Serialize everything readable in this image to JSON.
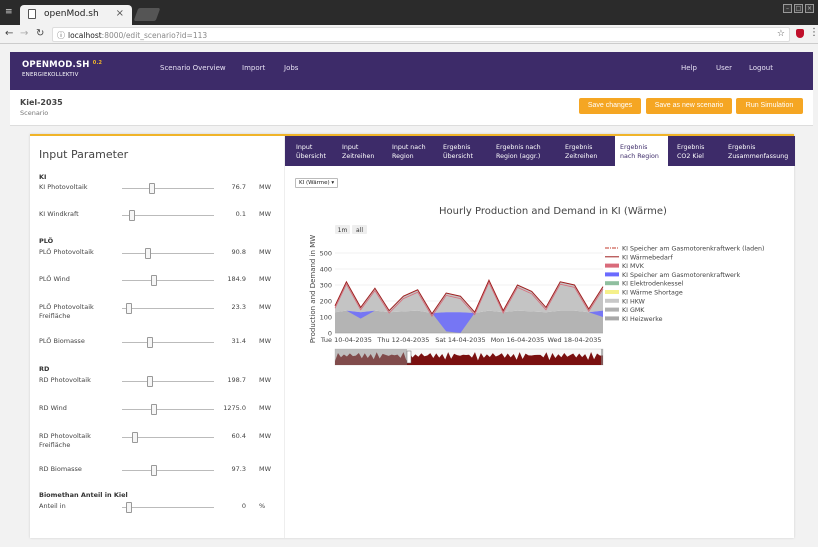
{
  "browser": {
    "tab_title": "openMod.sh",
    "tab_close": "×",
    "url_host": "localhost",
    "url_rest": ":8000/edit_scenario?id=113"
  },
  "nav": {
    "brand": "OPENMOD.SH",
    "version": "0.2",
    "subtitle": "ENERGIEKOLLEKTIV",
    "links": [
      "Scenario Overview",
      "Import",
      "Jobs"
    ],
    "right_links": [
      "Help",
      "User",
      "Logout"
    ]
  },
  "scenario": {
    "name": "Kiel-2035",
    "type": "Scenario",
    "buttons": [
      "Save changes",
      "Save as new scenario",
      "Run Simulation"
    ]
  },
  "params": {
    "title": "Input Parameter",
    "sections": [
      {
        "title": "KI",
        "items": [
          {
            "label": "KI Photovoltaik",
            "value": "76.7",
            "unit": "MW",
            "pos": 0.33
          },
          {
            "label": "KI Windkraft",
            "value": "0.1",
            "unit": "MW",
            "pos": 0.11
          }
        ]
      },
      {
        "title": "PLÖ",
        "items": [
          {
            "label": "PLÖ Photovoltaik",
            "value": "90.8",
            "unit": "MW",
            "pos": 0.27
          },
          {
            "label": "PLÖ Wind",
            "value": "184.9",
            "unit": "MW",
            "pos": 0.33
          },
          {
            "label": "PLÖ Photovoltaik Freifläche",
            "value": "23.3",
            "unit": "MW",
            "pos": 0.05
          },
          {
            "label": "PLÖ Biomasse",
            "value": "31.4",
            "unit": "MW",
            "pos": 0.29
          }
        ]
      },
      {
        "title": "RD",
        "items": [
          {
            "label": "RD Photovoltaik",
            "value": "198.7",
            "unit": "MW",
            "pos": 0.29
          },
          {
            "label": "RD Wind",
            "value": "1275.0",
            "unit": "MW",
            "pos": 0.33
          },
          {
            "label": "RD Photovoltaik Freifläche",
            "value": "60.4",
            "unit": "MW",
            "pos": 0.11
          },
          {
            "label": "RD Biomasse",
            "value": "97.3",
            "unit": "MW",
            "pos": 0.33
          }
        ]
      },
      {
        "title": "Biomethan Anteil in Kiel",
        "items": [
          {
            "label": "Anteil in",
            "value": "0",
            "unit": "%",
            "pos": 0.05
          }
        ]
      }
    ]
  },
  "tabs": [
    {
      "line1": "Input",
      "line2": "Übersicht",
      "active": false
    },
    {
      "line1": "Input",
      "line2": "Zeitreihen",
      "active": false
    },
    {
      "line1": "Input nach",
      "line2": "Region",
      "active": false
    },
    {
      "line1": "Ergebnis",
      "line2": "Übersicht",
      "active": false
    },
    {
      "line1": "Ergebnis nach",
      "line2": "Region (aggr.)",
      "active": false
    },
    {
      "line1": "Ergebnis",
      "line2": "Zeitreihen",
      "active": false
    },
    {
      "line1": "Ergebnis",
      "line2": "nach Region",
      "active": true
    },
    {
      "line1": "Ergebnis",
      "line2": "CO2 Kiel",
      "active": false
    },
    {
      "line1": "Ergebnis",
      "line2": "Zusammenfassung",
      "active": false
    }
  ],
  "region_select": "KI (Wärme)",
  "range_buttons": [
    "1m",
    "all"
  ],
  "colors": {
    "brand": "#3d2b69",
    "accent": "#f5a623"
  },
  "chart_data": {
    "type": "area",
    "title": "Hourly Production and Demand in KI (Wärme)",
    "ylabel": "Production and Demand in MW",
    "ylim": [
      0,
      550
    ],
    "yticks": [
      0,
      100,
      200,
      300,
      400,
      500
    ],
    "xticks": [
      "Tue 10-04-2035",
      "Thu 12-04-2035",
      "Sat 14-04-2035",
      "Mon 16-04-2035",
      "Wed 18-04-2035"
    ],
    "x_days": [
      9.6,
      10,
      10.5,
      11,
      11.5,
      12,
      12.5,
      13,
      13.5,
      14,
      14.5,
      15,
      15.5,
      16,
      16.5,
      17,
      17.5,
      18,
      18.5,
      19
    ],
    "series": [
      {
        "name": "KI Speicher am Gasmotorenkraftwerk (laden)",
        "color": "#c0392b",
        "style": "dashdot"
      },
      {
        "name": "KI Wärmebedarf",
        "color": "#a02020",
        "style": "line",
        "values": [
          170,
          320,
          160,
          280,
          140,
          230,
          270,
          120,
          250,
          230,
          130,
          330,
          140,
          300,
          260,
          160,
          320,
          300,
          150,
          290
        ]
      },
      {
        "name": "KI MVK",
        "color": "#d96b7a",
        "style": "area"
      },
      {
        "name": "KI Speicher am Gasmotorenkraftwerk",
        "color": "#6b6bff",
        "style": "area",
        "values": [
          0,
          0,
          40,
          0,
          0,
          0,
          0,
          0,
          120,
          140,
          0,
          0,
          0,
          0,
          0,
          0,
          0,
          0,
          0,
          40
        ]
      },
      {
        "name": "KI Elektrodenkessel",
        "color": "#8fbf9f",
        "style": "area"
      },
      {
        "name": "KI Wärme Shortage",
        "color": "#f5f08a",
        "style": "area"
      },
      {
        "name": "KI HKW",
        "color": "#c8c8c8",
        "style": "area"
      },
      {
        "name": "KI GMK",
        "color": "#b0b0b0",
        "style": "area"
      },
      {
        "name": "KI Heizwerke",
        "color": "#a8a8a8",
        "style": "area",
        "values": [
          130,
          140,
          130,
          140,
          130,
          135,
          140,
          125,
          130,
          130,
          125,
          140,
          130,
          140,
          135,
          130,
          140,
          140,
          130,
          140
        ]
      }
    ],
    "grid": true,
    "legend_position": "right"
  }
}
